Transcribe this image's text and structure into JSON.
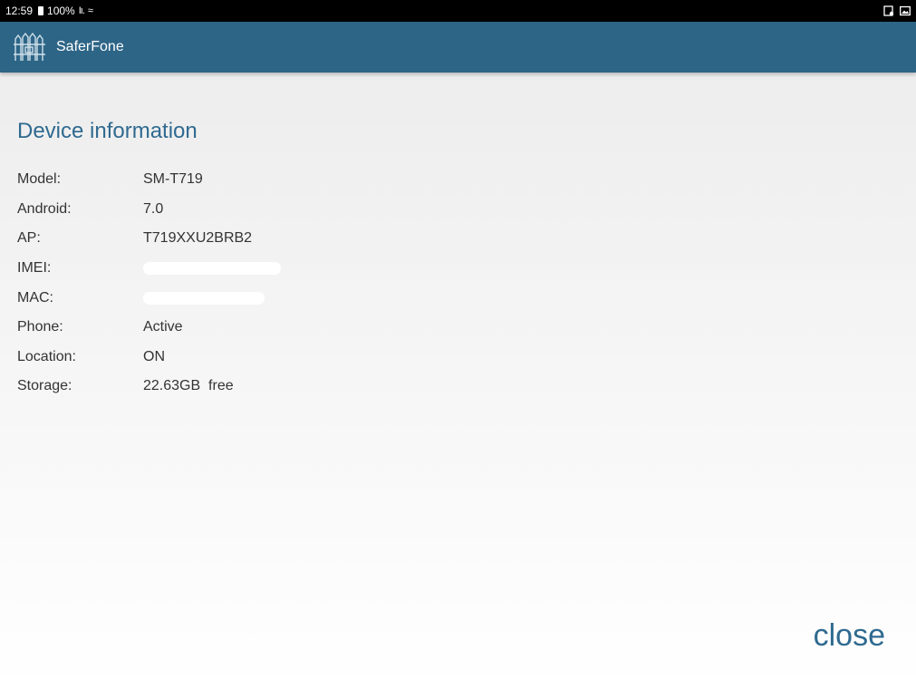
{
  "status_bar": {
    "time": "12:59",
    "battery": "100%",
    "icons": [
      "battery-icon",
      "signal-icon",
      "wifi-icon",
      "screenshot-icon",
      "gallery-icon"
    ]
  },
  "app_bar": {
    "title": "SaferFone",
    "logo_icon": "fence-logo-icon",
    "color": "#2d6587"
  },
  "section": {
    "title": "Device information"
  },
  "device_info": [
    {
      "label": "Model:",
      "value": "SM-T719"
    },
    {
      "label": "Android:",
      "value": "7.0"
    },
    {
      "label": "AP:",
      "value": "T719XXU2BRB2"
    },
    {
      "label": "IMEI:",
      "value": ""
    },
    {
      "label": "MAC:",
      "value": ""
    },
    {
      "label": "Phone:",
      "value": "Active"
    },
    {
      "label": "Location:",
      "value": "ON"
    },
    {
      "label": "Storage:",
      "value": "22.63GB  free"
    }
  ],
  "close_label": "close",
  "accent_color": "#2f6a90"
}
